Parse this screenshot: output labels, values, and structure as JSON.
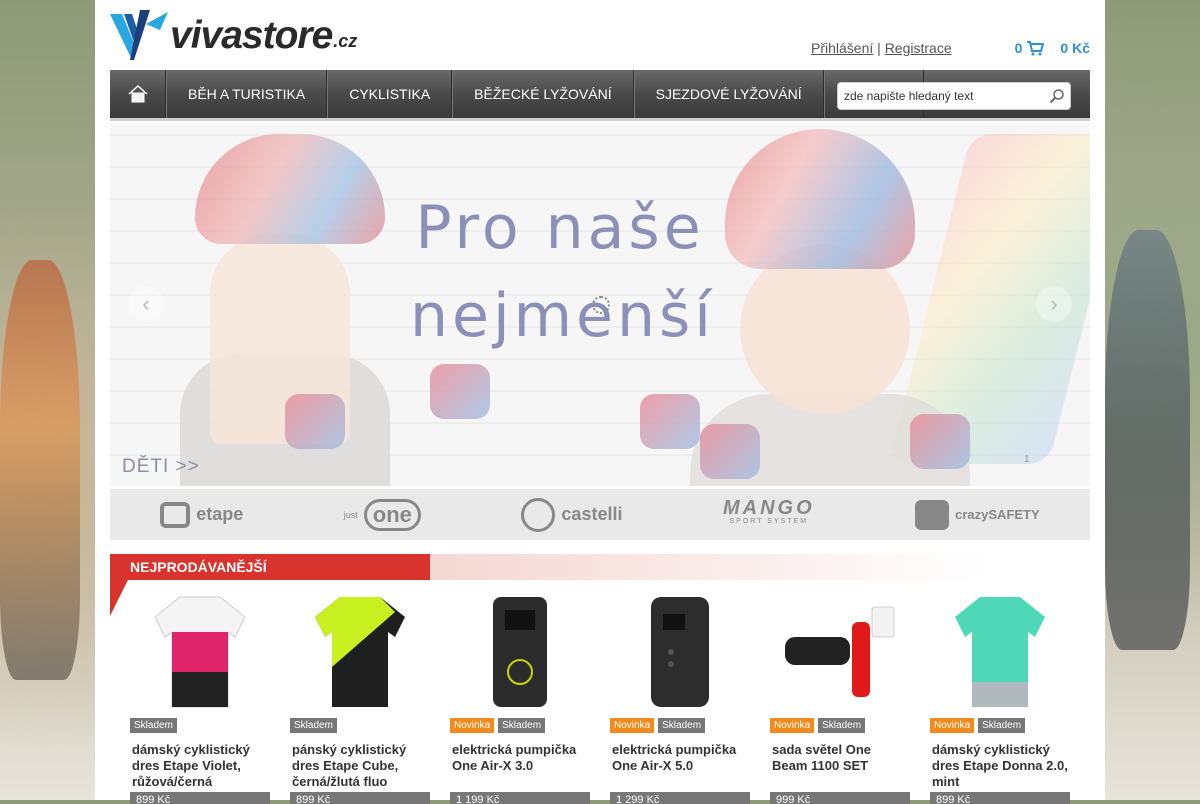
{
  "header": {
    "logo_text": "vivastore",
    "logo_tld": ".cz",
    "login_label": "Přihlášení",
    "separator": "|",
    "register_label": "Registrace",
    "cart_count": "0",
    "cart_total": "0 Kč"
  },
  "nav": {
    "home_icon": "home-icon",
    "items": [
      {
        "label": "BĚH A TURISTIKA"
      },
      {
        "label": "CYKLISTIKA"
      },
      {
        "label": "BĚŽECKÉ LYŽOVÁNÍ"
      },
      {
        "label": "SJEZDOVÉ LYŽOVÁNÍ"
      }
    ]
  },
  "search": {
    "placeholder": "zde napište hledaný text",
    "icon": "search-icon"
  },
  "hero": {
    "title_line1": "Pro naše",
    "title_line2": "nejmenší",
    "caption": "DĚTI >>",
    "page_number": "1",
    "prev_icon": "chevron-left-icon",
    "next_icon": "chevron-right-icon"
  },
  "brands": [
    {
      "name": "etape"
    },
    {
      "name": "one",
      "tagline": "just"
    },
    {
      "name": "castelli"
    },
    {
      "name": "MANGO",
      "tagline": "SPORT SYSTEM"
    },
    {
      "name": "crazySAFETY"
    }
  ],
  "bestsellers": {
    "title": "NEJPRODÁVANĚJŠÍ",
    "products": [
      {
        "name": "dámský cyklistický dres Etape Violet, růžová/černá",
        "badges": [
          "Skladem"
        ],
        "price": "899 Kč",
        "colors": [
          "#e0246a",
          "#222222"
        ]
      },
      {
        "name": "pánský cyklistický dres Etape Cube, černá/žlutá fluo",
        "badges": [
          "Skladem"
        ],
        "price": "899 Kč",
        "colors": [
          "#c8f021",
          "#1f1f1f"
        ]
      },
      {
        "name": "elektrická pumpička One Air-X 3.0",
        "badges": [
          "Novinka",
          "Skladem"
        ],
        "price": "1 199 Kč",
        "colors": [
          "#2b2b2b",
          "#c8d400"
        ]
      },
      {
        "name": "elektrická pumpička One Air-X 5.0",
        "badges": [
          "Novinka",
          "Skladem"
        ],
        "price": "1 299 Kč",
        "colors": [
          "#2d2d2d",
          "#1a1a1a"
        ]
      },
      {
        "name": "sada světel One Beam 1100 SET",
        "badges": [
          "Novinka",
          "Skladem"
        ],
        "price": "999 Kč",
        "colors": [
          "#222222",
          "#e01a1a"
        ]
      },
      {
        "name": "dámský cyklistický dres Etape Donna 2.0, mint",
        "badges": [
          "Novinka",
          "Skladem"
        ],
        "price": "899 Kč",
        "colors": [
          "#4fd8b8",
          "#f2a7c0"
        ]
      }
    ]
  },
  "colors": {
    "accent_blue": "#2d8fd8",
    "section_red": "#d9332d",
    "badge_new": "#f08a1c",
    "badge_stock": "#777777"
  }
}
